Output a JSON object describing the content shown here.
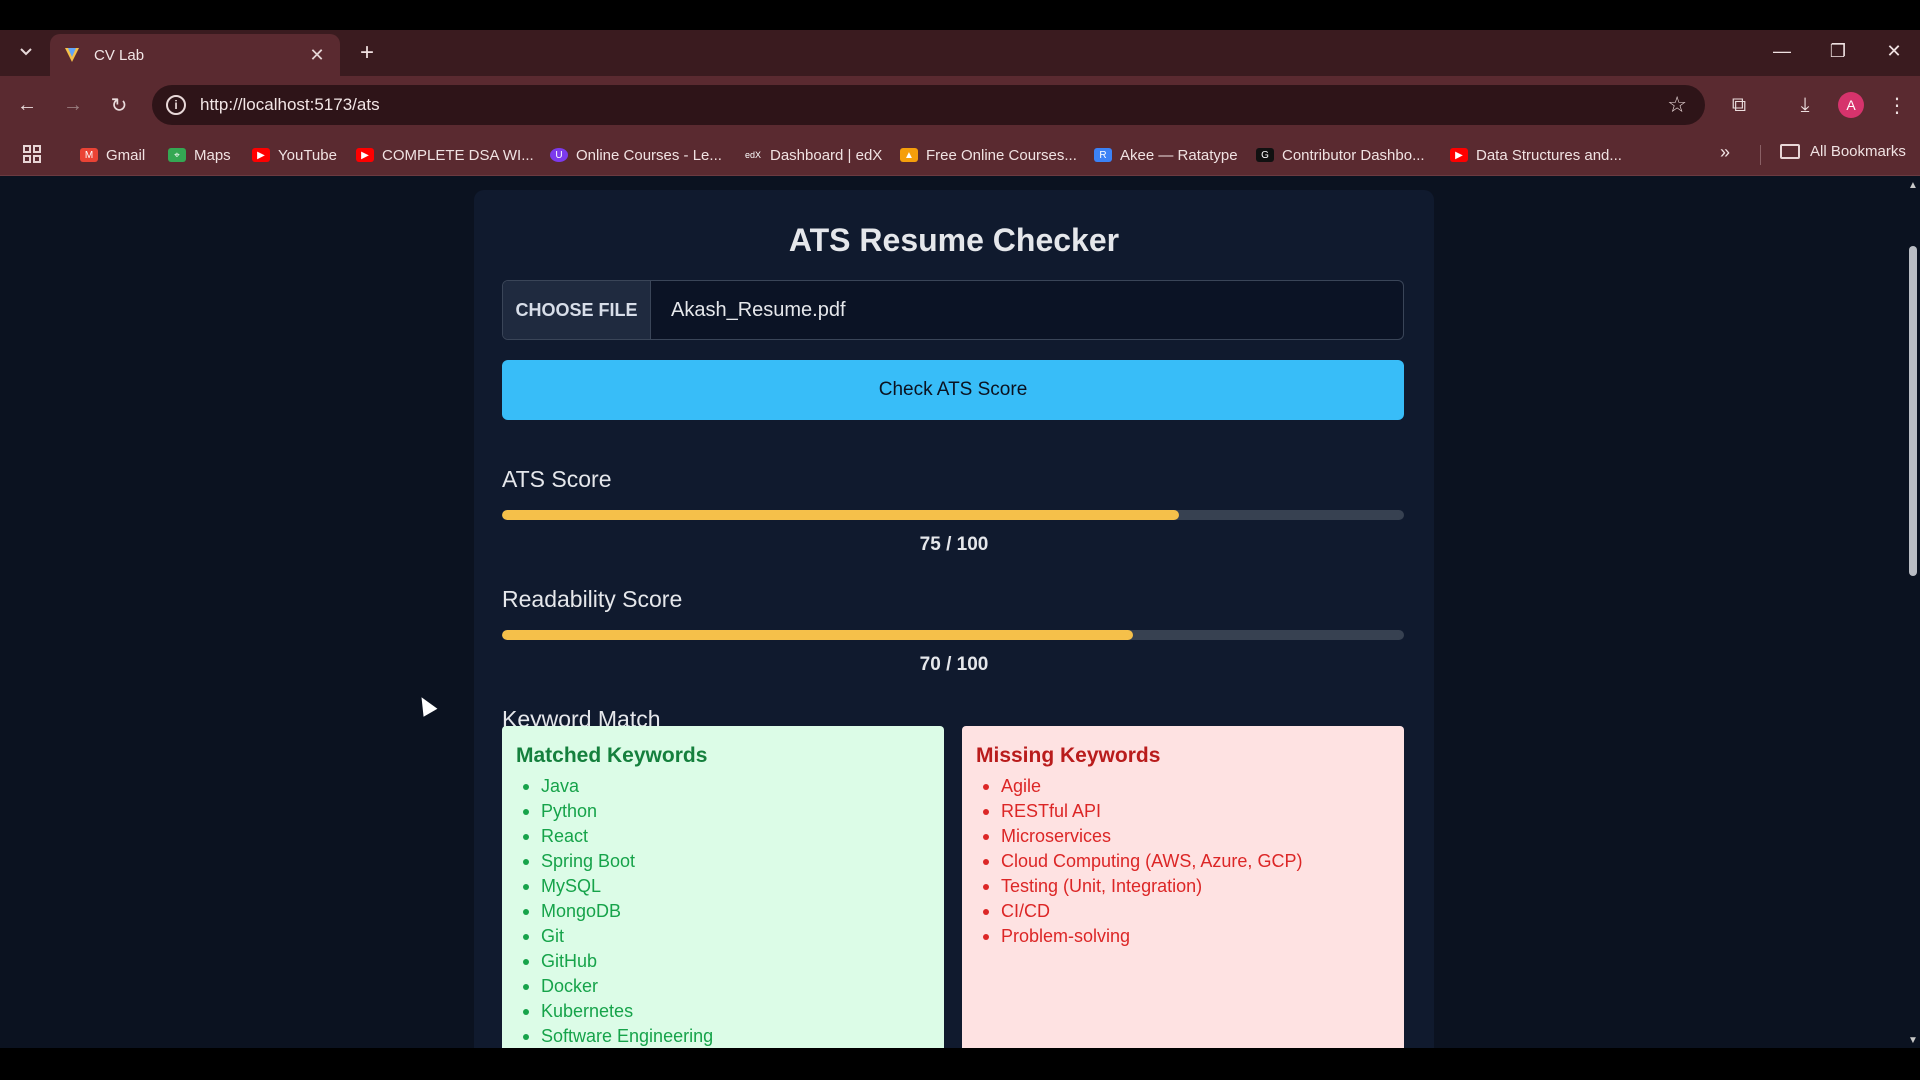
{
  "browser": {
    "tab_title": "CV Lab",
    "url": "http://localhost:5173/ats",
    "avatar_letter": "A",
    "bookmarks": [
      {
        "label": "Gmail",
        "color": "#ea4335"
      },
      {
        "label": "Maps",
        "color": "#34a853"
      },
      {
        "label": "YouTube",
        "color": "#ff0000"
      },
      {
        "label": "COMPLETE DSA WI...",
        "color": "#ff0000"
      },
      {
        "label": "Online Courses - Le...",
        "color": "#7c3aed"
      },
      {
        "label": "Dashboard | edX",
        "color": "#5a2a30"
      },
      {
        "label": "Free Online Courses...",
        "color": "#f59e0b"
      },
      {
        "label": "Akee — Ratatype",
        "color": "#3b82f6"
      },
      {
        "label": "Contributor Dashbo...",
        "color": "#111111"
      },
      {
        "label": "Data Structures and...",
        "color": "#ff0000"
      }
    ],
    "all_bookmarks": "All Bookmarks"
  },
  "page": {
    "title": "ATS Resume Checker",
    "choose_file_label": "CHOOSE FILE",
    "file_name": "Akash_Resume.pdf",
    "check_button": "Check ATS Score",
    "ats": {
      "label": "ATS Score",
      "text": "75 / 100",
      "value": 75,
      "max": 100
    },
    "readability": {
      "label": "Readability Score",
      "text": "70 / 100",
      "value": 70,
      "max": 100
    },
    "keyword_title": "Keyword Match",
    "matched": {
      "heading": "Matched Keywords",
      "items": [
        "Java",
        "Python",
        "React",
        "Spring Boot",
        "MySQL",
        "MongoDB",
        "Git",
        "GitHub",
        "Docker",
        "Kubernetes",
        "Software Engineering"
      ]
    },
    "missing": {
      "heading": "Missing Keywords",
      "items": [
        "Agile",
        "RESTful API",
        "Microservices",
        "Cloud Computing (AWS, Azure, GCP)",
        "Testing (Unit, Integration)",
        "CI/CD",
        "Problem-solving"
      ]
    }
  },
  "colors": {
    "accent": "#38bdf8",
    "bar": "#f5c04a",
    "background": "#0b1220"
  }
}
